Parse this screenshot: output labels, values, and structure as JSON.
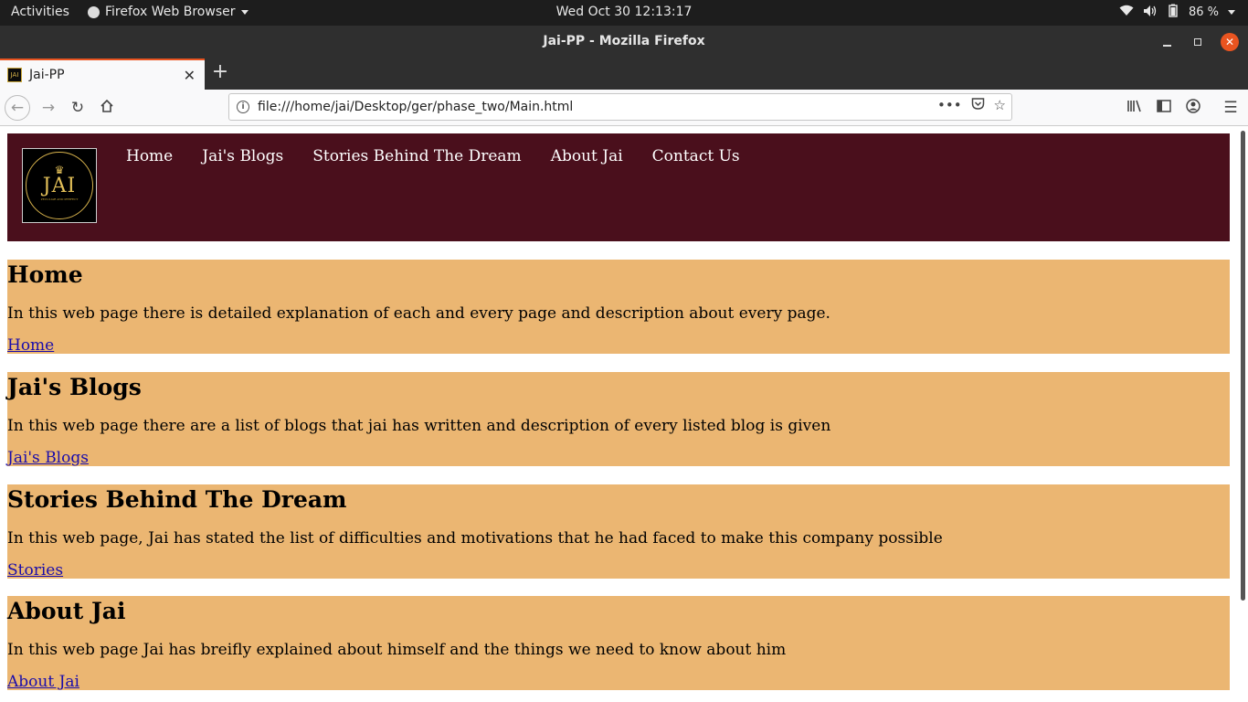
{
  "system_bar": {
    "activities": "Activities",
    "app_name": "Firefox Web Browser",
    "datetime": "Wed Oct 30  12:13:17",
    "battery": "86 %"
  },
  "window": {
    "title": "Jai-PP - Mozilla Firefox"
  },
  "tab": {
    "title": "Jai-PP",
    "favicon_text": "JAI"
  },
  "url": "file:///home/jai/Desktop/ger/phase_two/Main.html",
  "site": {
    "logo_text": "JAI",
    "logo_tagline": "PECULIAR AND PERFECT",
    "nav": [
      "Home",
      "Jai's Blogs",
      "Stories Behind The Dream",
      "About Jai",
      "Contact Us"
    ],
    "colors": {
      "header_bg": "#4a0f1c",
      "section_bg": "#ebb672",
      "link": "#1a0dab"
    }
  },
  "sections": [
    {
      "heading": "Home",
      "description": "In this web page there is detailed explanation of each and every page and description about every page.",
      "link": "Home"
    },
    {
      "heading": "Jai's Blogs",
      "description": "In this web page there are a list of blogs that jai has written and description of every listed blog is given",
      "link": "Jai's Blogs"
    },
    {
      "heading": "Stories Behind The Dream",
      "description": "In this web page, Jai has stated the list of difficulties and motivations that he had faced to make this company possible",
      "link": "Stories"
    },
    {
      "heading": "About Jai",
      "description": "In this web page Jai has breifly explained about himself and the things we need to know about him",
      "link": "About Jai"
    }
  ]
}
